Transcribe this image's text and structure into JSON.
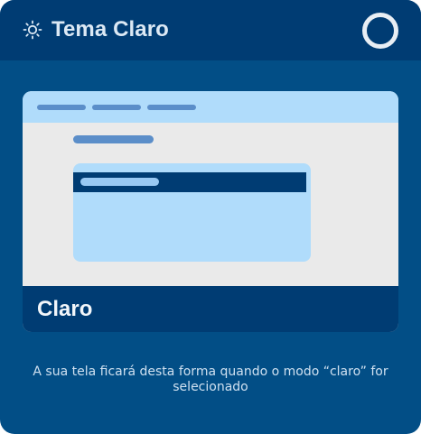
{
  "header": {
    "icon": "sun-icon",
    "title": "Tema Claro",
    "toggle_icon": "ring-toggle-icon"
  },
  "preview": {
    "label": "Claro"
  },
  "description": "A sua tela ficará desta forma quando o modo “claro” for selecionado",
  "colors": {
    "card_background": "#024e86",
    "header_background": "#003c73",
    "preview_surface": "#eaeaea",
    "preview_accent": "#b0dcfb",
    "preview_placeholder": "#5b8ec9",
    "text_light": "#dce9f5"
  }
}
